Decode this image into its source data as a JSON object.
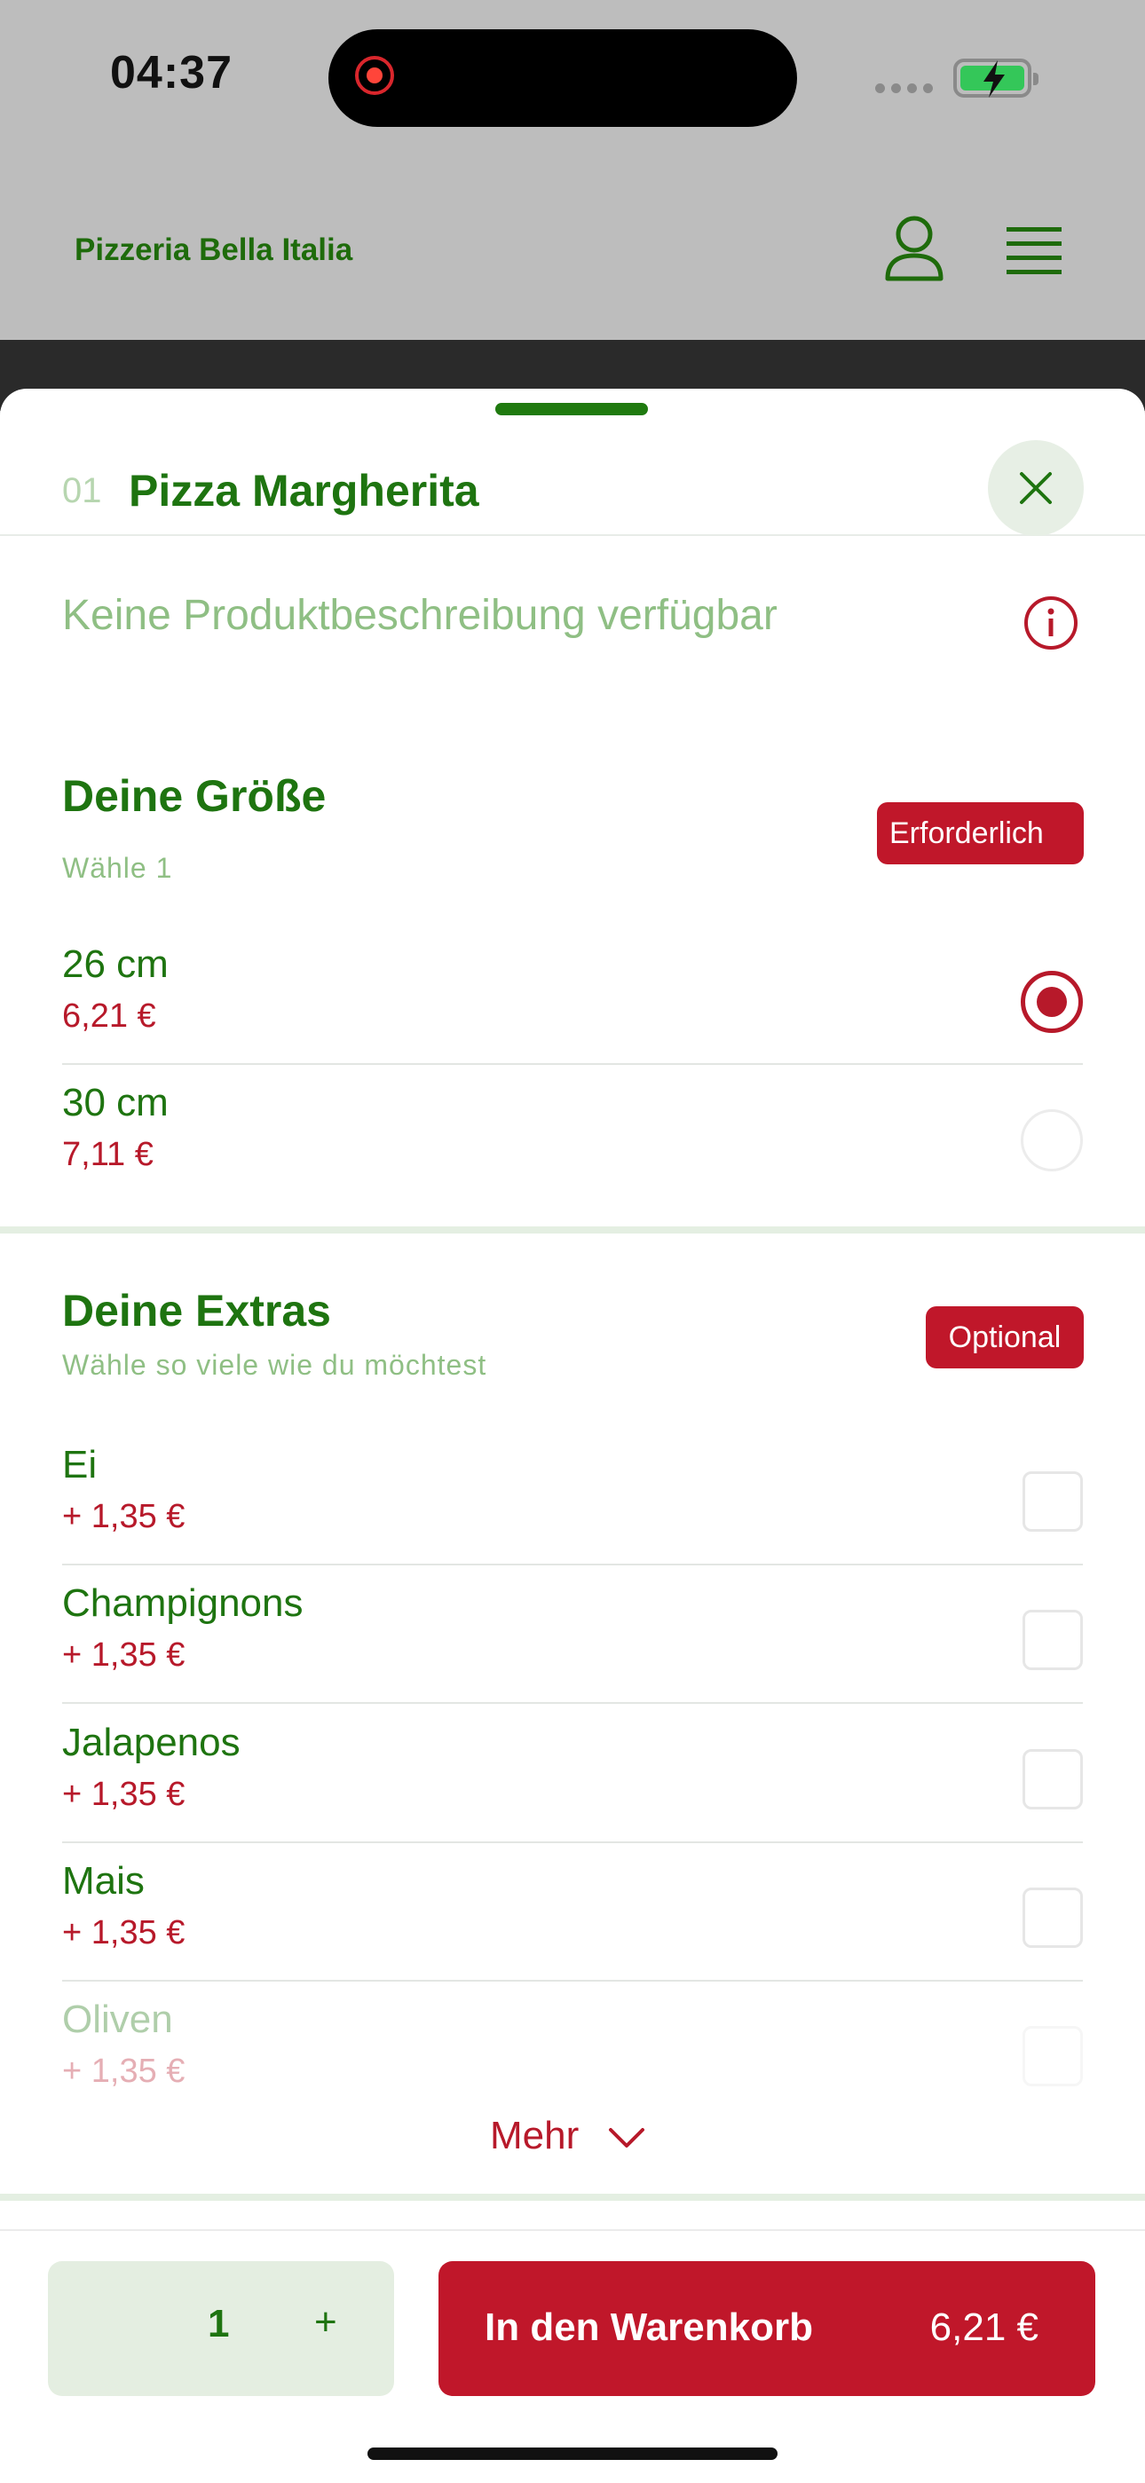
{
  "status_bar": {
    "time": "04:37"
  },
  "header": {
    "brand": "Pizzeria Bella Italia"
  },
  "product": {
    "number": "01",
    "name": "Pizza Margherita",
    "description": "Keine Produktbeschreibung verfügbar"
  },
  "size_section": {
    "title": "Deine Größe",
    "subtitle": "Wähle 1",
    "badge": "Erforderlich",
    "options": [
      {
        "name": "26 cm",
        "price": "6,21 €",
        "selected": true
      },
      {
        "name": "30 cm",
        "price": "7,11 €",
        "selected": false
      }
    ]
  },
  "extras_section": {
    "title": "Deine Extras",
    "subtitle": "Wähle so viele wie du möchtest",
    "badge": "Optional",
    "options": [
      {
        "name": "Ei",
        "price": "+ 1,35 €"
      },
      {
        "name": "Champignons",
        "price": "+ 1,35 €"
      },
      {
        "name": "Jalapenos",
        "price": "+ 1,35 €"
      },
      {
        "name": "Mais",
        "price": "+ 1,35 €"
      },
      {
        "name": "Oliven",
        "price": "+ 1,35 €"
      }
    ],
    "more_label": "Mehr"
  },
  "footer": {
    "quantity": "1",
    "plus": "+",
    "add_to_cart": "In den Warenkorb",
    "total": "6,21 €"
  },
  "colors": {
    "brand_green": "#1e7410",
    "accent_red": "#c0172a",
    "light_green": "#e4eee1"
  },
  "icons": [
    "record-icon",
    "battery-charging-icon",
    "user-icon",
    "menu-icon",
    "close-icon",
    "info-icon",
    "chevron-down-icon"
  ]
}
